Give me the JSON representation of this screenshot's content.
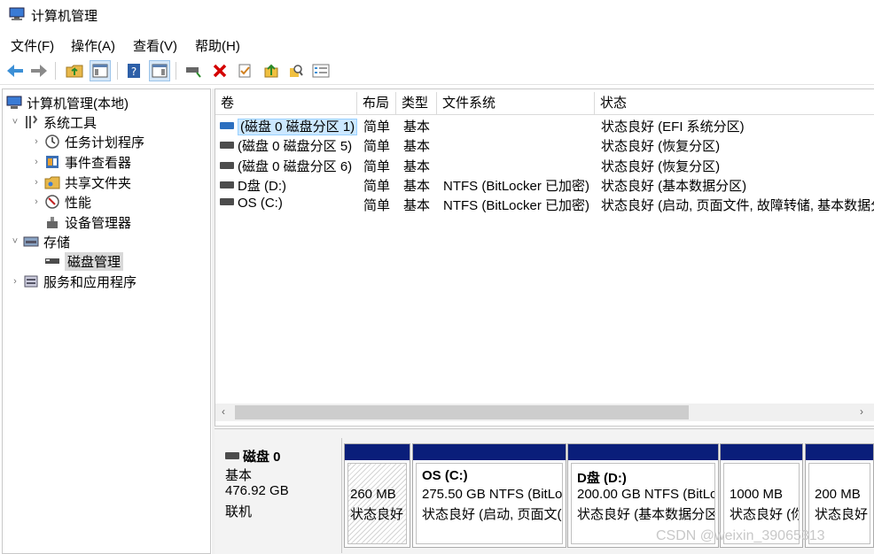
{
  "window": {
    "title": "计算机管理"
  },
  "menu": [
    "文件(F)",
    "操作(A)",
    "查看(V)",
    "帮助(H)"
  ],
  "toolbar": {
    "buttons": [
      "back-icon",
      "forward-icon",
      "up-folder-icon",
      "show-hide-tree-icon",
      "help-icon",
      "show-hide-action-pane-icon",
      "connect-drive-icon",
      "delete-icon",
      "properties-icon",
      "import-icon",
      "search-icon",
      "view-icon"
    ]
  },
  "tree": {
    "root": "计算机管理(本地)",
    "system_tools": "系统工具",
    "task_scheduler": "任务计划程序",
    "event_viewer": "事件查看器",
    "shared_folders": "共享文件夹",
    "performance": "性能",
    "device_manager": "设备管理器",
    "storage": "存储",
    "disk_management": "磁盘管理",
    "services_apps": "服务和应用程序",
    "expanded_glyph": "˅",
    "collapsed_glyph": "›"
  },
  "volumes": {
    "columns": [
      "卷",
      "布局",
      "类型",
      "文件系统",
      "状态"
    ],
    "rows": [
      {
        "volume": "(磁盘 0 磁盘分区 1)",
        "layout": "简单",
        "type": "基本",
        "fs": "",
        "status": "状态良好 (EFI 系统分区)"
      },
      {
        "volume": "(磁盘 0 磁盘分区 5)",
        "layout": "简单",
        "type": "基本",
        "fs": "",
        "status": "状态良好 (恢复分区)"
      },
      {
        "volume": "(磁盘 0 磁盘分区 6)",
        "layout": "简单",
        "type": "基本",
        "fs": "",
        "status": "状态良好 (恢复分区)"
      },
      {
        "volume": "D盘 (D:)",
        "layout": "简单",
        "type": "基本",
        "fs": "NTFS (BitLocker 已加密)",
        "status": "状态良好 (基本数据分区)"
      },
      {
        "volume": "OS (C:)",
        "layout": "简单",
        "type": "基本",
        "fs": "NTFS (BitLocker 已加密)",
        "status": "状态良好 (启动, 页面文件, 故障转储, 基本数据分"
      }
    ],
    "selected_index": 0
  },
  "scrollbar": {
    "left_arrow": "‹",
    "right_arrow": "›"
  },
  "disk": {
    "name": "磁盘 0",
    "type": "基本",
    "size": "476.92 GB",
    "state": "联机",
    "partitions": [
      {
        "name": "",
        "size": "260 MB",
        "status": "状态良好",
        "hatched": true
      },
      {
        "name": "OS  (C:)",
        "size": "275.50 GB NTFS (BitLo",
        "status": "状态良好 (启动, 页面文(",
        "hatched": false
      },
      {
        "name": "D盘  (D:)",
        "size": "200.00 GB NTFS (BitLo",
        "status": "状态良好 (基本数据分区",
        "hatched": false
      },
      {
        "name": "",
        "size": "1000 MB",
        "status": "状态良好 (你",
        "hatched": false
      },
      {
        "name": "",
        "size": "200 MB",
        "status": "状态良好",
        "hatched": false
      }
    ]
  },
  "watermark": "CSDN @weixin_39065313",
  "colors": {
    "partition_header": "#0a1e7a",
    "selection": "#cce8ff",
    "delete_red": "#d40000"
  }
}
